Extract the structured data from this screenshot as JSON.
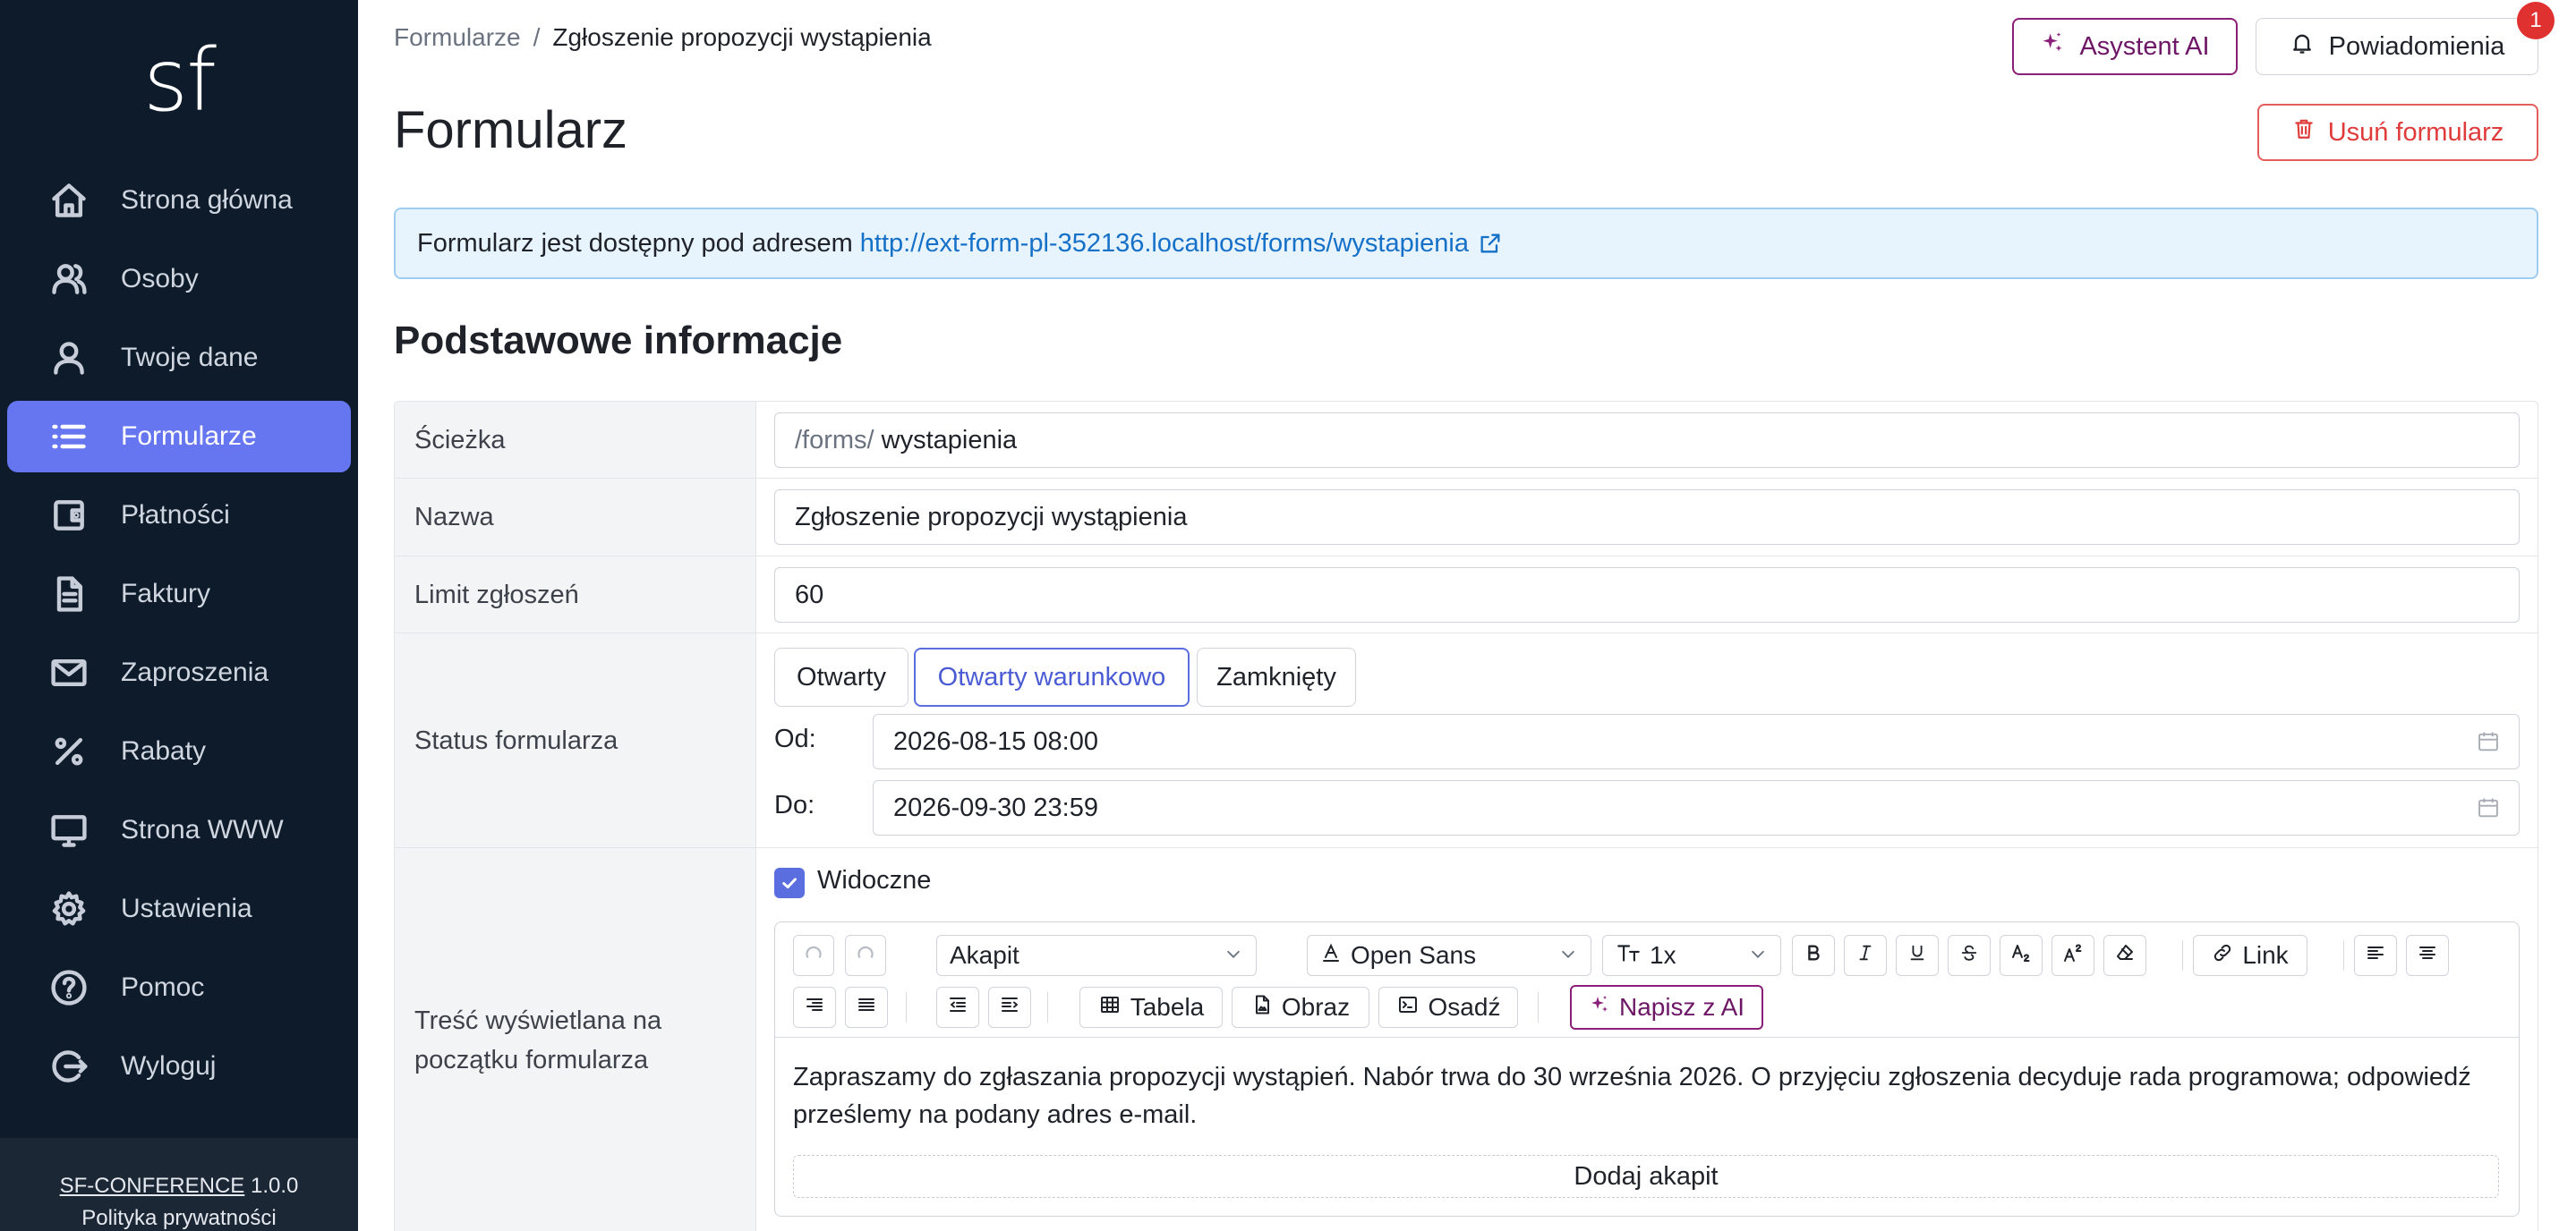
{
  "sidebar": {
    "logo": "sf",
    "items": [
      {
        "label": "Strona główna",
        "icon": "home-icon"
      },
      {
        "label": "Osoby",
        "icon": "people-icon"
      },
      {
        "label": "Twoje dane",
        "icon": "user-icon"
      },
      {
        "label": "Formularze",
        "icon": "list-icon",
        "active": true
      },
      {
        "label": "Płatności",
        "icon": "wallet-icon"
      },
      {
        "label": "Faktury",
        "icon": "document-icon"
      },
      {
        "label": "Zaproszenia",
        "icon": "mail-icon"
      },
      {
        "label": "Rabaty",
        "icon": "percent-icon"
      },
      {
        "label": "Strona WWW",
        "icon": "monitor-icon"
      },
      {
        "label": "Ustawienia",
        "icon": "gear-icon"
      },
      {
        "label": "Pomoc",
        "icon": "help-icon"
      },
      {
        "label": "Wyloguj",
        "icon": "logout-icon"
      }
    ],
    "footer": {
      "app_name": "SF-CONFERENCE",
      "version": "1.0.0",
      "privacy": "Polityka prywatności"
    }
  },
  "header": {
    "breadcrumb": {
      "parent": "Formularze",
      "separator": "/",
      "current": "Zgłoszenie propozycji wystąpienia"
    },
    "ai_button": "Asystent AI",
    "notifications_button": "Powiadomienia",
    "notifications_count": "1",
    "title": "Formularz",
    "delete_button": "Usuń formularz"
  },
  "info": {
    "text": "Formularz jest dostępny pod adresem",
    "url": "http://ext-form-pl-352136.localhost/forms/wystapienia"
  },
  "section": {
    "title": "Podstawowe informacje"
  },
  "fields": {
    "path": {
      "label": "Ścieżka",
      "prefix": "/forms/",
      "value": "wystapienia"
    },
    "name": {
      "label": "Nazwa",
      "value": "Zgłoszenie propozycji wystąpienia"
    },
    "limit": {
      "label": "Limit zgłoszeń",
      "value": "60"
    },
    "status": {
      "label": "Status formularza",
      "options": [
        "Otwarty",
        "Otwarty warunkowo",
        "Zamknięty"
      ],
      "selected": "Otwarty warunkowo",
      "from_label": "Od:",
      "from_value": "2026-08-15 08:00",
      "to_label": "Do:",
      "to_value": "2026-09-30 23:59"
    },
    "content": {
      "label": "Treść wyświetlana na początku formularza",
      "visible_label": "Widoczne",
      "visible": true,
      "toolbar": {
        "block_type": "Akapit",
        "font": "Open Sans",
        "size": "1x",
        "link": "Link",
        "table": "Tabela",
        "image": "Obraz",
        "embed": "Osadź",
        "ai_write": "Napisz z AI"
      },
      "text": "Zapraszamy do zgłaszania propozycji wystąpień. Nabór trwa do 30 września 2026. O przyjęciu zgłoszenia decyduje rada programowa; odpowiedź prześlemy na podany adres e-mail.",
      "add_paragraph": "Dodaj akapit"
    }
  },
  "colors": {
    "sidebar_bg": "#0d1b2a",
    "active_nav": "#6675f0",
    "ai_accent": "#8a1f7a",
    "danger": "#e03b3b",
    "info_bg": "#e7f3fd",
    "link": "#1570c8"
  }
}
